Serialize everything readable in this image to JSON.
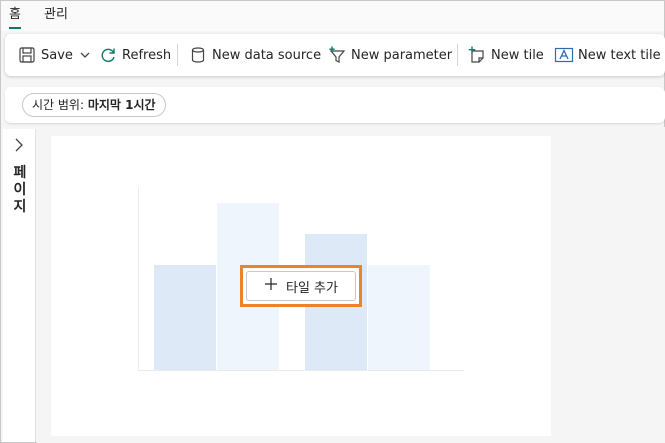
{
  "tabs": [
    {
      "label": "홈",
      "active": true
    },
    {
      "label": "관리",
      "active": false
    }
  ],
  "ribbon": {
    "save_label": "Save",
    "refresh_label": "Refresh",
    "new_data_source_label": "New data source",
    "new_parameter_label": "New parameter",
    "new_tile_label": "New tile",
    "new_text_tile_label": "New text tile"
  },
  "filter": {
    "prefix": "시간 범위: ",
    "value": "마지막 1시간"
  },
  "pages_pane": {
    "label": "페이지"
  },
  "canvas": {
    "add_tile_label": "타일 추가",
    "placeholder_fill_light": "#eef5fc",
    "placeholder_fill_dark": "#dde9f6"
  },
  "colors": {
    "accent_tab": "#117865",
    "highlight_border": "#e8842e",
    "icon_teal": "#117865"
  }
}
